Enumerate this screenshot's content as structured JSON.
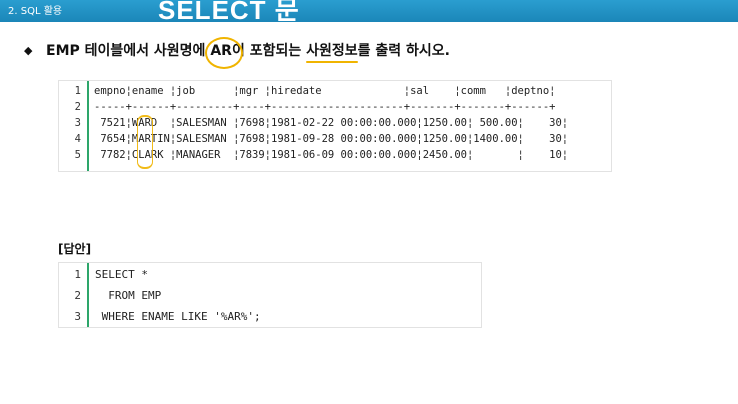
{
  "header": {
    "section_label": "2. SQL 활용",
    "title": "SELECT 문"
  },
  "question": {
    "bullet": "◆",
    "before": "EMP 테이블에서 사원명에 ",
    "keyword": "AR",
    "middle": "이 포함되는 ",
    "underlined": "사원정보",
    "after": "를 출력 하시오."
  },
  "result": {
    "line_numbers": [
      "1",
      "2",
      "3",
      "4",
      "5"
    ],
    "lines": [
      "empno¦ename ¦job      ¦mgr ¦hiredate             ¦sal    ¦comm   ¦deptno¦",
      "-----+------+---------+----+---------------------+-------+-------+------+",
      " 7521¦WARD  ¦SALESMAN ¦7698¦1981-02-22 00:00:00.000¦1250.00¦ 500.00¦    30¦",
      " 7654¦MARTIN¦SALESMAN ¦7698¦1981-09-28 00:00:00.000¦1250.00¦1400.00¦    30¦",
      " 7782¦CLARK ¦MANAGER  ¦7839¦1981-06-09 00:00:00.000¦2450.00¦       ¦    10¦"
    ]
  },
  "answer": {
    "label": "[답안]",
    "line_numbers": [
      "1",
      "2",
      "3"
    ],
    "lines": [
      "SELECT *",
      "  FROM EMP",
      " WHERE ENAME LIKE '%AR%';"
    ]
  }
}
